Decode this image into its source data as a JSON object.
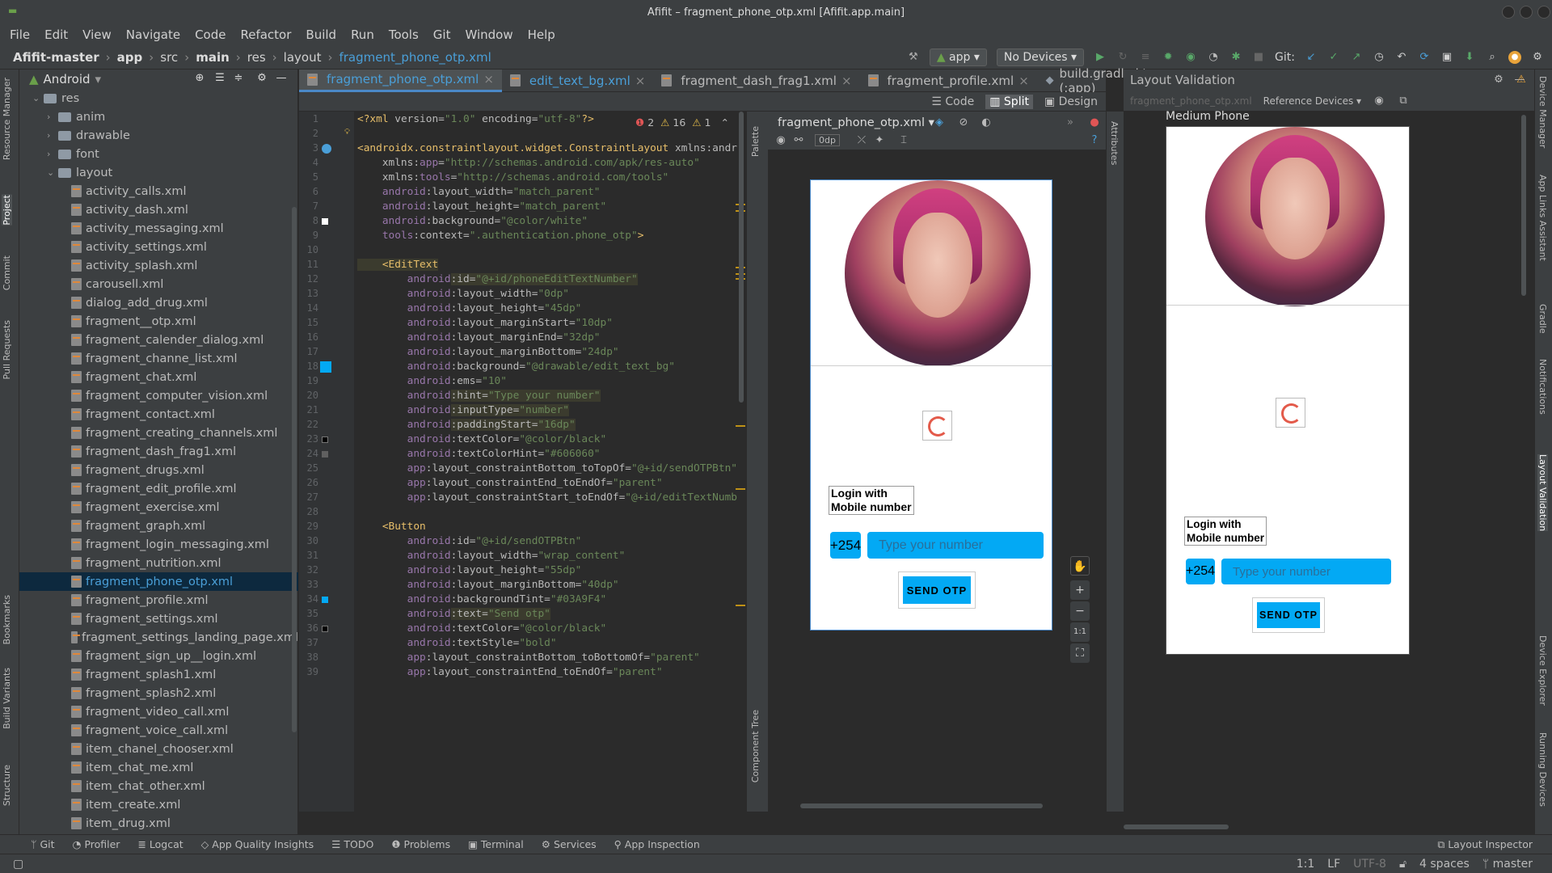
{
  "window": {
    "title": "Afifit – fragment_phone_otp.xml [Afifit.app.main]"
  },
  "menu": [
    "File",
    "Edit",
    "View",
    "Navigate",
    "Code",
    "Refactor",
    "Build",
    "Run",
    "Tools",
    "Git",
    "Window",
    "Help"
  ],
  "breadcrumbs": [
    "Afifit-master",
    "app",
    "src",
    "main",
    "res",
    "layout",
    "fragment_phone_otp.xml"
  ],
  "toolbar": {
    "run_config": "app",
    "device": "No Devices",
    "git_label": "Git:"
  },
  "project": {
    "view_mode": "Android",
    "root": "res",
    "folders": [
      "anim",
      "drawable",
      "font",
      "layout"
    ],
    "files": [
      "activity_calls.xml",
      "activity_dash.xml",
      "activity_messaging.xml",
      "activity_settings.xml",
      "activity_splash.xml",
      "carousell.xml",
      "dialog_add_drug.xml",
      "fragment__otp.xml",
      "fragment_calender_dialog.xml",
      "fragment_channe_list.xml",
      "fragment_chat.xml",
      "fragment_computer_vision.xml",
      "fragment_contact.xml",
      "fragment_creating_channels.xml",
      "fragment_dash_frag1.xml",
      "fragment_drugs.xml",
      "fragment_edit_profile.xml",
      "fragment_exercise.xml",
      "fragment_graph.xml",
      "fragment_login_messaging.xml",
      "fragment_nutrition.xml",
      "fragment_phone_otp.xml",
      "fragment_profile.xml",
      "fragment_settings.xml",
      "fragment_settings_landing_page.xml",
      "fragment_sign_up__login.xml",
      "fragment_splash1.xml",
      "fragment_splash2.xml",
      "fragment_video_call.xml",
      "fragment_voice_call.xml",
      "item_chanel_chooser.xml",
      "item_chat_me.xml",
      "item_chat_other.xml",
      "item_create.xml",
      "item_drug.xml"
    ],
    "selected": "fragment_phone_otp.xml"
  },
  "left_tabs": [
    "Resource Manager",
    "Project",
    "Commit",
    "Pull Requests",
    "Bookmarks",
    "Build Variants",
    "Structure"
  ],
  "right_tabs": [
    "Device Manager",
    "App Links Assistant",
    "Gradle",
    "Notifications",
    "Layout Validation",
    "Device Explorer",
    "Running Devices"
  ],
  "editor_tabs": [
    "fragment_phone_otp.xml",
    "edit_text_bg.xml",
    "fragment_dash_frag1.xml",
    "fragment_profile.xml",
    "build.gradle.kts (:app)"
  ],
  "editor_modes": [
    "Code",
    "Split",
    "Design"
  ],
  "inspections": {
    "errors": "2",
    "warnings": "16",
    "weak": "1"
  },
  "code_lines": [
    {
      "n": "1",
      "parts": [
        [
          "tag",
          "<?xml "
        ],
        [
          "attr",
          "version="
        ],
        [
          "val",
          "\"1.0\""
        ],
        [
          "attr",
          " encoding="
        ],
        [
          "val",
          "\"utf-8\""
        ],
        [
          "tag",
          "?>"
        ]
      ]
    },
    {
      "n": "2",
      "parts": []
    },
    {
      "n": "3",
      "parts": [
        [
          "tag",
          "<androidx.constraintlayout.widget.ConstraintLayout "
        ],
        [
          "attr",
          "xmlns:andr"
        ]
      ]
    },
    {
      "n": "4",
      "parts": [
        [
          "attr",
          "    xmlns:"
        ],
        [
          "ns",
          "app"
        ],
        [
          "attr",
          "="
        ],
        [
          "val",
          "\"http://schemas.android.com/apk/res-auto\""
        ]
      ]
    },
    {
      "n": "5",
      "parts": [
        [
          "attr",
          "    xmlns:"
        ],
        [
          "ns",
          "tools"
        ],
        [
          "attr",
          "="
        ],
        [
          "val",
          "\"http://schemas.android.com/tools\""
        ]
      ]
    },
    {
      "n": "6",
      "parts": [
        [
          "ns",
          "    android"
        ],
        [
          "attr",
          ":layout_width="
        ],
        [
          "val",
          "\"match_parent\""
        ]
      ]
    },
    {
      "n": "7",
      "parts": [
        [
          "ns",
          "    android"
        ],
        [
          "attr",
          ":layout_height="
        ],
        [
          "val",
          "\"match_parent\""
        ]
      ]
    },
    {
      "n": "8",
      "parts": [
        [
          "ns",
          "    android"
        ],
        [
          "attr",
          ":background="
        ],
        [
          "val",
          "\"@color/white\""
        ]
      ]
    },
    {
      "n": "9",
      "parts": [
        [
          "ns",
          "    tools"
        ],
        [
          "attr",
          ":context="
        ],
        [
          "val",
          "\".authentication.phone_otp\""
        ],
        [
          "tag",
          ">"
        ]
      ]
    },
    {
      "n": "10",
      "parts": []
    },
    {
      "n": "11",
      "parts": [
        [
          "tag",
          "    <EditText"
        ]
      ]
    },
    {
      "n": "12",
      "parts": [
        [
          "ns",
          "        android"
        ],
        [
          "attr",
          ":id="
        ],
        [
          "val",
          "\"@+id/phoneEditTextNumber\""
        ]
      ]
    },
    {
      "n": "13",
      "parts": [
        [
          "ns",
          "        android"
        ],
        [
          "attr",
          ":layout_width="
        ],
        [
          "val",
          "\"0dp\""
        ]
      ]
    },
    {
      "n": "14",
      "parts": [
        [
          "ns",
          "        android"
        ],
        [
          "attr",
          ":layout_height="
        ],
        [
          "val",
          "\"45dp\""
        ]
      ]
    },
    {
      "n": "15",
      "parts": [
        [
          "ns",
          "        android"
        ],
        [
          "attr",
          ":layout_marginStart="
        ],
        [
          "val",
          "\"10dp\""
        ]
      ]
    },
    {
      "n": "16",
      "parts": [
        [
          "ns",
          "        android"
        ],
        [
          "attr",
          ":layout_marginEnd="
        ],
        [
          "val",
          "\"32dp\""
        ]
      ]
    },
    {
      "n": "17",
      "parts": [
        [
          "ns",
          "        android"
        ],
        [
          "attr",
          ":layout_marginBottom="
        ],
        [
          "val",
          "\"24dp\""
        ]
      ]
    },
    {
      "n": "18",
      "parts": [
        [
          "ns",
          "        android"
        ],
        [
          "attr",
          ":background="
        ],
        [
          "val",
          "\"@drawable/edit_text_bg\""
        ]
      ]
    },
    {
      "n": "19",
      "parts": [
        [
          "ns",
          "        android"
        ],
        [
          "attr",
          ":ems="
        ],
        [
          "val",
          "\"10\""
        ]
      ]
    },
    {
      "n": "20",
      "parts": [
        [
          "ns",
          "        android"
        ],
        [
          "attr",
          ":hint="
        ],
        [
          "val",
          "\"Type your number\""
        ]
      ]
    },
    {
      "n": "21",
      "parts": [
        [
          "ns",
          "        android"
        ],
        [
          "attr",
          ":inputType="
        ],
        [
          "val",
          "\"number\""
        ]
      ]
    },
    {
      "n": "22",
      "parts": [
        [
          "ns",
          "        android"
        ],
        [
          "attr",
          ":paddingStart="
        ],
        [
          "val",
          "\"16dp\""
        ]
      ]
    },
    {
      "n": "23",
      "parts": [
        [
          "ns",
          "        android"
        ],
        [
          "attr",
          ":textColor="
        ],
        [
          "val",
          "\"@color/black\""
        ]
      ]
    },
    {
      "n": "24",
      "parts": [
        [
          "ns",
          "        android"
        ],
        [
          "attr",
          ":textColorHint="
        ],
        [
          "val",
          "\"#606060\""
        ]
      ]
    },
    {
      "n": "25",
      "parts": [
        [
          "ns",
          "        app"
        ],
        [
          "attr",
          ":layout_constraintBottom_toTopOf="
        ],
        [
          "val",
          "\"@+id/sendOTPBtn\""
        ]
      ]
    },
    {
      "n": "26",
      "parts": [
        [
          "ns",
          "        app"
        ],
        [
          "attr",
          ":layout_constraintEnd_toEndOf="
        ],
        [
          "val",
          "\"parent\""
        ]
      ]
    },
    {
      "n": "27",
      "parts": [
        [
          "ns",
          "        app"
        ],
        [
          "attr",
          ":layout_constraintStart_toEndOf="
        ],
        [
          "val",
          "\"@+id/editTextNumb"
        ]
      ]
    },
    {
      "n": "28",
      "parts": []
    },
    {
      "n": "29",
      "parts": [
        [
          "tag",
          "    <Button"
        ]
      ]
    },
    {
      "n": "30",
      "parts": [
        [
          "ns",
          "        android"
        ],
        [
          "attr",
          ":id="
        ],
        [
          "val",
          "\"@+id/sendOTPBtn\""
        ]
      ]
    },
    {
      "n": "31",
      "parts": [
        [
          "ns",
          "        android"
        ],
        [
          "attr",
          ":layout_width="
        ],
        [
          "val",
          "\"wrap_content\""
        ]
      ]
    },
    {
      "n": "32",
      "parts": [
        [
          "ns",
          "        android"
        ],
        [
          "attr",
          ":layout_height="
        ],
        [
          "val",
          "\"55dp\""
        ]
      ]
    },
    {
      "n": "33",
      "parts": [
        [
          "ns",
          "        android"
        ],
        [
          "attr",
          ":layout_marginBottom="
        ],
        [
          "val",
          "\"40dp\""
        ]
      ]
    },
    {
      "n": "34",
      "parts": [
        [
          "ns",
          "        android"
        ],
        [
          "attr",
          ":backgroundTint="
        ],
        [
          "val",
          "\"#03A9F4\""
        ]
      ]
    },
    {
      "n": "35",
      "parts": [
        [
          "ns",
          "        android"
        ],
        [
          "attr",
          ":text="
        ],
        [
          "val",
          "\"Send otp\""
        ]
      ]
    },
    {
      "n": "36",
      "parts": [
        [
          "ns",
          "        android"
        ],
        [
          "attr",
          ":textColor="
        ],
        [
          "val",
          "\"@color/black\""
        ]
      ]
    },
    {
      "n": "37",
      "parts": [
        [
          "ns",
          "        android"
        ],
        [
          "attr",
          ":textStyle="
        ],
        [
          "val",
          "\"bold\""
        ]
      ]
    },
    {
      "n": "38",
      "parts": [
        [
          "ns",
          "        app"
        ],
        [
          "attr",
          ":layout_constraintBottom_toBottomOf="
        ],
        [
          "val",
          "\"parent\""
        ]
      ]
    },
    {
      "n": "39",
      "parts": [
        [
          "ns",
          "        app"
        ],
        [
          "attr",
          ":layout_constraintEnd_toEndOf="
        ],
        [
          "val",
          "\"parent\""
        ]
      ]
    }
  ],
  "design": {
    "file_combo": "fragment_phone_otp.xml",
    "margin": "0dp",
    "palette_label": "Palette",
    "attributes_label": "Attributes",
    "component_tree_label": "Component Tree",
    "zoom_reset": "1:1"
  },
  "preview": {
    "login_label_line1": "Login with",
    "login_label_line2": "Mobile number",
    "country_code": "+254",
    "hint": "Type your number",
    "send_button": "SEND OTP"
  },
  "validation": {
    "title": "Layout Validation",
    "file": "fragment_phone_otp.xml",
    "reference": "Reference Devices",
    "device_name": "Medium Phone"
  },
  "bottom_tools": [
    "Git",
    "Profiler",
    "Logcat",
    "App Quality Insights",
    "TODO",
    "Problems",
    "Terminal",
    "Services",
    "App Inspection"
  ],
  "bottom_right_tool": "Layout Inspector",
  "status": {
    "position": "1:1",
    "line_sep": "LF",
    "encoding": "UTF-8",
    "indent": "4 spaces",
    "branch": "master"
  }
}
